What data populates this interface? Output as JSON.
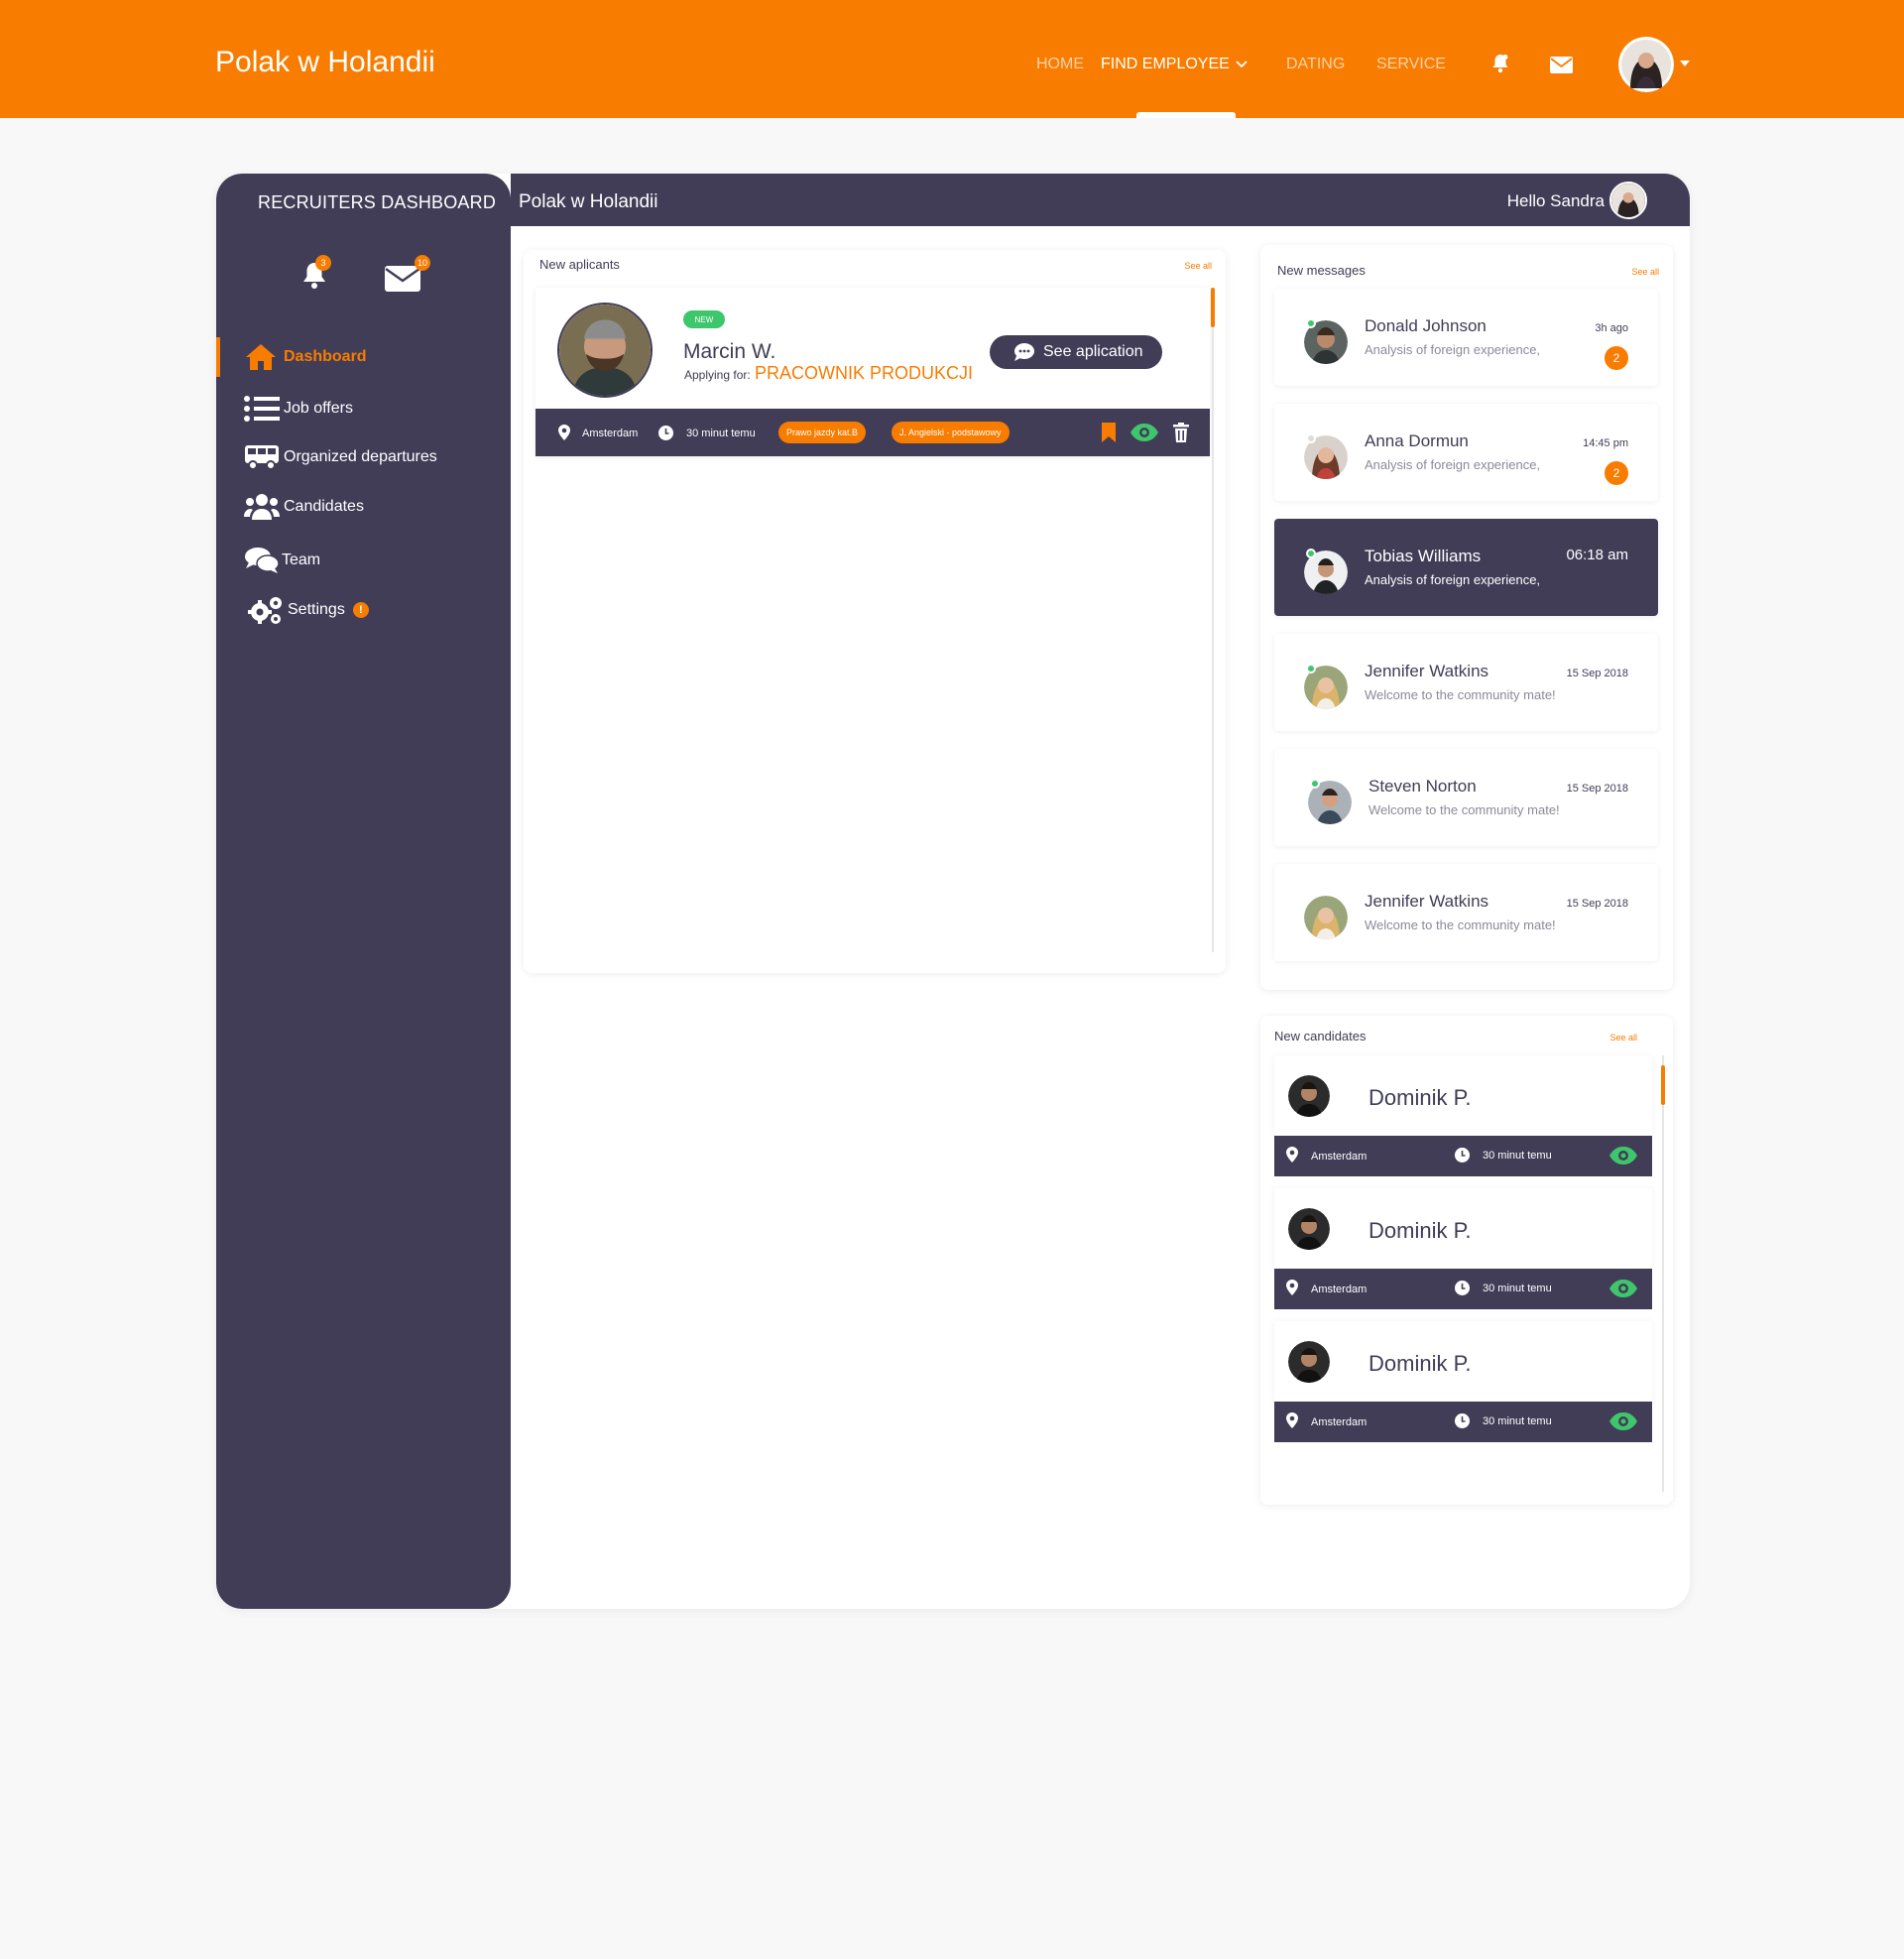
{
  "topbar": {
    "brand": "Polak w Holandii",
    "nav": {
      "home": "HOME",
      "find_employee": "FIND EMPLOYEE",
      "dating": "DATING",
      "service": "SERVICE"
    },
    "icons": [
      "bell-icon",
      "mail-icon",
      "user-avatar",
      "caret-down-icon"
    ],
    "brand_color": "#f87c00"
  },
  "dashboard": {
    "sidebar_title": "RECRUITERS DASHBOARD",
    "header_title": "Polak w Holandii",
    "greeting": "Hello Sandra",
    "bell_badge": "3",
    "mail_badge": "10",
    "menu": [
      {
        "label": "Dashboard",
        "icon": "home-icon",
        "active": true
      },
      {
        "label": "Job offers",
        "icon": "list-icon"
      },
      {
        "label": "Organized departures",
        "icon": "bus-icon"
      },
      {
        "label": "Candidates",
        "icon": "users-icon"
      },
      {
        "label": "Team",
        "icon": "comments-icon"
      },
      {
        "label": "Settings",
        "icon": "cogs-icon",
        "alert": "!"
      }
    ],
    "dark_color": "#413d57"
  },
  "applicants": {
    "title": "New aplicants",
    "see_all": "See all",
    "items": [
      {
        "badge": "NEW",
        "name": "Marcin W.",
        "applying_label": "Applying for:",
        "job": "PRACOWNIK PRODUKCJI",
        "button": "See aplication",
        "location": "Amsterdam",
        "time": "30 minut temu",
        "tags": [
          "Prawo jazdy kat.B",
          "J. Angielski - podstawowy"
        ]
      }
    ]
  },
  "messages": {
    "title": "New messages",
    "see_all": "See all",
    "items": [
      {
        "name": "Donald Johnson",
        "text": "Analysis of foreign experience,",
        "time": "3h ago",
        "count": "2",
        "online": true
      },
      {
        "name": "Anna Dormun",
        "text": "Analysis of foreign experience,",
        "time": "14:45 pm",
        "count": "2",
        "online": false
      },
      {
        "name": "Tobias Williams",
        "text": "Analysis of foreign experience,",
        "time": "06:18 am",
        "online": true,
        "selected": true
      },
      {
        "name": "Jennifer Watkins",
        "text": "Welcome to the community mate!",
        "time": "15 Sep 2018",
        "online": true
      },
      {
        "name": "Steven Norton",
        "text": "Welcome to the community mate!",
        "time": "15 Sep 2018",
        "online": true
      },
      {
        "name": "Jennifer Watkins",
        "text": "Welcome to the community mate!",
        "time": "15 Sep 2018",
        "online": false
      }
    ]
  },
  "candidates": {
    "title": "New candidates",
    "see_all": "See all",
    "items": [
      {
        "name": "Dominik P.",
        "location": "Amsterdam",
        "time": "30 minut temu"
      },
      {
        "name": "Dominik P.",
        "location": "Amsterdam",
        "time": "30 minut temu"
      },
      {
        "name": "Dominik P.",
        "location": "Amsterdam",
        "time": "30 minut temu"
      }
    ]
  }
}
